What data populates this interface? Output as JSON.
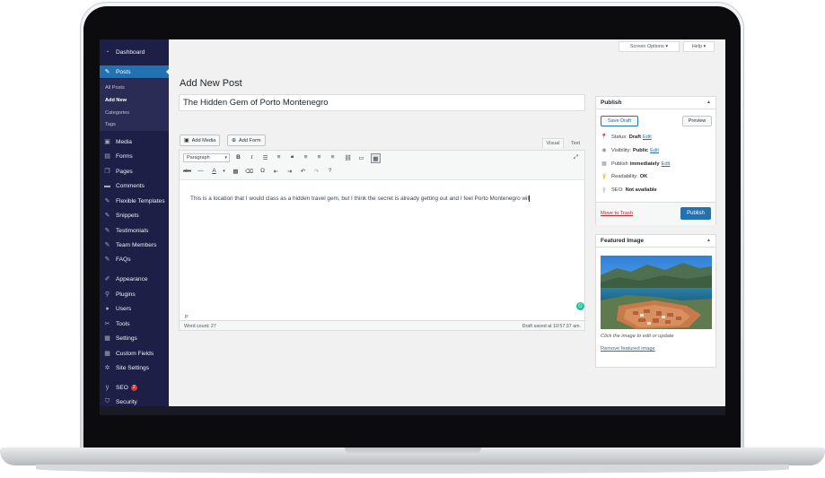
{
  "sidebar": {
    "items": [
      {
        "label": "Dashboard",
        "icon": "dashboard-icon"
      },
      {
        "label": "Posts",
        "icon": "pin-icon"
      },
      {
        "label": "Media",
        "icon": "media-icon"
      },
      {
        "label": "Forms",
        "icon": "forms-icon"
      },
      {
        "label": "Pages",
        "icon": "pages-icon"
      },
      {
        "label": "Comments",
        "icon": "comments-icon"
      },
      {
        "label": "Flexible Templates",
        "icon": "pin-icon"
      },
      {
        "label": "Snippets",
        "icon": "pin-icon"
      },
      {
        "label": "Testimonials",
        "icon": "pin-icon"
      },
      {
        "label": "Team Members",
        "icon": "pin-icon"
      },
      {
        "label": "FAQs",
        "icon": "pin-icon"
      },
      {
        "label": "Appearance",
        "icon": "brush-icon"
      },
      {
        "label": "Plugins",
        "icon": "plugin-icon"
      },
      {
        "label": "Users",
        "icon": "users-icon"
      },
      {
        "label": "Tools",
        "icon": "wrench-icon"
      },
      {
        "label": "Settings",
        "icon": "settings-icon"
      },
      {
        "label": "Custom Fields",
        "icon": "fields-icon"
      },
      {
        "label": "Site Settings",
        "icon": "gear-icon"
      },
      {
        "label": "SEO",
        "icon": "seo-icon",
        "badge": "2"
      },
      {
        "label": "Security",
        "icon": "shield-icon"
      }
    ],
    "posts_submenu": [
      "All Posts",
      "Add New",
      "Categories",
      "Tags"
    ]
  },
  "header": {
    "screen_options": "Screen Options ▾",
    "help": "Help ▾",
    "page_title": "Add New Post"
  },
  "post": {
    "title": "The Hidden Gem of Porto Montenegro",
    "add_media": "Add Media",
    "add_form": "Add Form",
    "tab_visual": "Visual",
    "tab_text": "Text",
    "format_select": "Paragraph",
    "content": "This is a location that I would class as a hidden travel gem, but I think the secret is already getting out and I feel Porto Montenegro wil",
    "path": "P",
    "word_count": "Word count: 27",
    "saved": "Draft saved at 10:57:37 am."
  },
  "publish": {
    "title": "Publish",
    "save_draft": "Save Draft",
    "preview": "Preview",
    "status_label": "Status:",
    "status_value": "Draft",
    "visibility_label": "Visibility:",
    "visibility_value": "Public",
    "publish_label": "Publish",
    "publish_value": "immediately",
    "edit": "Edit",
    "readability_label": "Readability:",
    "readability_value": "OK",
    "seo_label": "SEO:",
    "seo_value": "Not available",
    "trash": "Move to Trash",
    "publish_button": "Publish"
  },
  "featured": {
    "title": "Featured Image",
    "caption": "Click the image to edit or update",
    "remove": "Remove featured image"
  },
  "colors": {
    "sidebar": "#1e1f46",
    "accent": "#2271b1",
    "trash": "#b32d2e"
  }
}
